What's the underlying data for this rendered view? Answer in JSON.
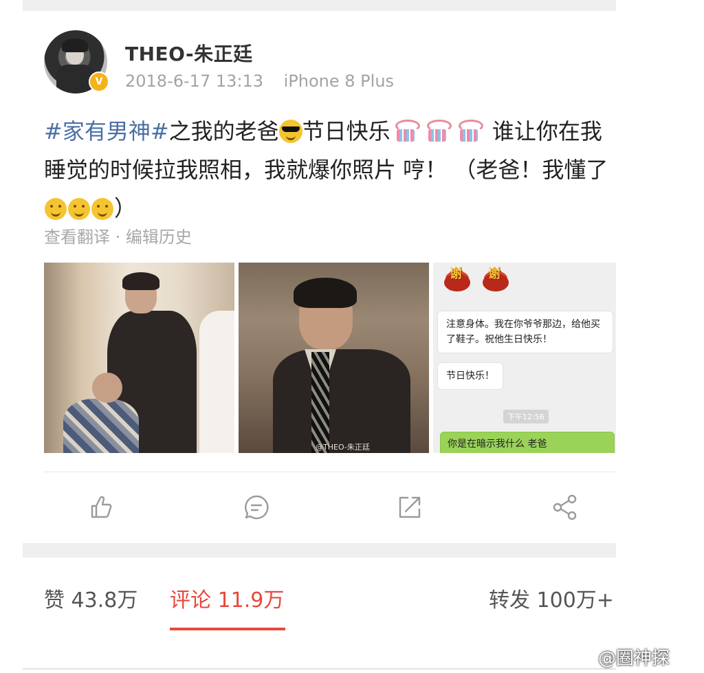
{
  "post": {
    "author": "THEO-朱正廷",
    "timestamp": "2018-6-17 13:13",
    "device": "iPhone 8 Plus",
    "text": {
      "hashtag": "#家有男神#",
      "part1": "之我的老爸",
      "part2": "节日快乐",
      "part3": " 谁让你在我睡觉的时候拉我照相，我就爆你照片 哼！ （老爸！我懂了",
      "part4": "）"
    },
    "links": "查看翻译 · 编辑历史",
    "photo2_watermark": "@THEO-朱正廷",
    "chat": {
      "msg1": "注意身体。我在你爷爷那边，给他买了鞋子。祝他生日快乐！",
      "msg2": "节日快乐！",
      "time": "下午12:56",
      "msg3": "你是在暗示我什么 老爸"
    }
  },
  "stats": {
    "likes": "赞 43.8万",
    "comments": "评论 11.9万",
    "reposts": "转发 100万+"
  },
  "watermark": "@圈神探",
  "colors": {
    "hashtag": "#4a6fa5",
    "active_tab": "#e8483b",
    "verified_badge": "#f4b31a"
  }
}
